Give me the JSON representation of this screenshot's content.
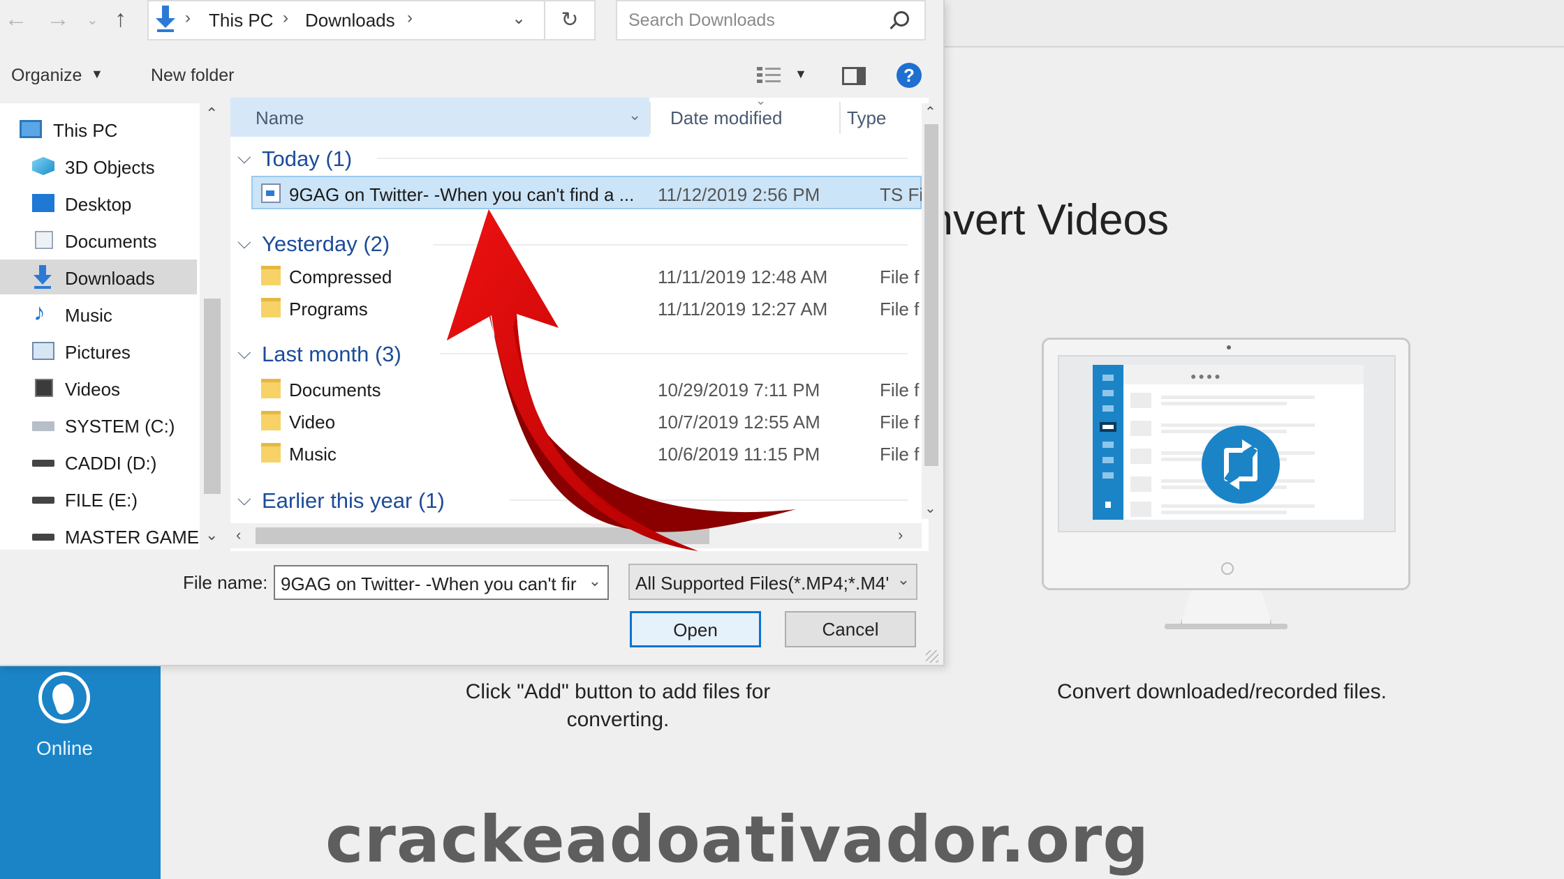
{
  "dialog": {
    "breadcrumb": [
      "This PC",
      "Downloads"
    ],
    "search_placeholder": "Search Downloads",
    "toolbar": {
      "organize": "Organize",
      "new_folder": "New folder",
      "help": "?"
    },
    "nav_items": [
      {
        "label": "This PC",
        "icon": "this-pc-icon"
      },
      {
        "label": "3D Objects",
        "icon": "3d-objects-icon"
      },
      {
        "label": "Desktop",
        "icon": "desktop-icon"
      },
      {
        "label": "Documents",
        "icon": "documents-icon"
      },
      {
        "label": "Downloads",
        "icon": "downloads-icon",
        "selected": true
      },
      {
        "label": "Music",
        "icon": "music-icon"
      },
      {
        "label": "Pictures",
        "icon": "pictures-icon"
      },
      {
        "label": "Videos",
        "icon": "videos-icon"
      },
      {
        "label": "SYSTEM (C:)",
        "icon": "system-drive-icon"
      },
      {
        "label": "CADDI (D:)",
        "icon": "drive-icon"
      },
      {
        "label": "FILE (E:)",
        "icon": "drive-icon"
      },
      {
        "label": "MASTER GAME (",
        "icon": "drive-icon"
      }
    ],
    "columns": {
      "name": "Name",
      "date": "Date modified",
      "type": "Type"
    },
    "groups": [
      {
        "label": "Today (1)",
        "rows": [
          {
            "name": "9GAG on Twitter- -When you can't find a ...",
            "date": "11/12/2019 2:56 PM",
            "type": "TS Fi",
            "kind": "ts",
            "selected": true
          }
        ]
      },
      {
        "label": "Yesterday (2)",
        "rows": [
          {
            "name": "Compressed",
            "date": "11/11/2019 12:48 AM",
            "type": "File f",
            "kind": "folder"
          },
          {
            "name": "Programs",
            "date": "11/11/2019 12:27 AM",
            "type": "File f",
            "kind": "folder"
          }
        ]
      },
      {
        "label": "Last month (3)",
        "rows": [
          {
            "name": "Documents",
            "date": "10/29/2019 7:11 PM",
            "type": "File f",
            "kind": "folder"
          },
          {
            "name": "Video",
            "date": "10/7/2019 12:55 AM",
            "type": "File f",
            "kind": "folder"
          },
          {
            "name": "Music",
            "date": "10/6/2019 11:15 PM",
            "type": "File f",
            "kind": "folder"
          }
        ]
      },
      {
        "label": "Earlier this year (1)",
        "rows": []
      }
    ],
    "file_name_label": "File name:",
    "file_name_value": "9GAG on Twitter- -When you can't fir",
    "file_type_value": "All Supported Files(*.MP4;*.M4'",
    "open_label": "Open",
    "cancel_label": "Cancel"
  },
  "app": {
    "title": "onvert Videos",
    "online_label": "Online",
    "hint_left": "Click \"Add\" button to add files for converting.",
    "hint_right": "Convert downloaded/recorded files."
  },
  "watermark": "crackeadoativador.org",
  "colors": {
    "accent": "#1b84c7",
    "arrow": "#d10000",
    "selection": "#cce4f7"
  }
}
